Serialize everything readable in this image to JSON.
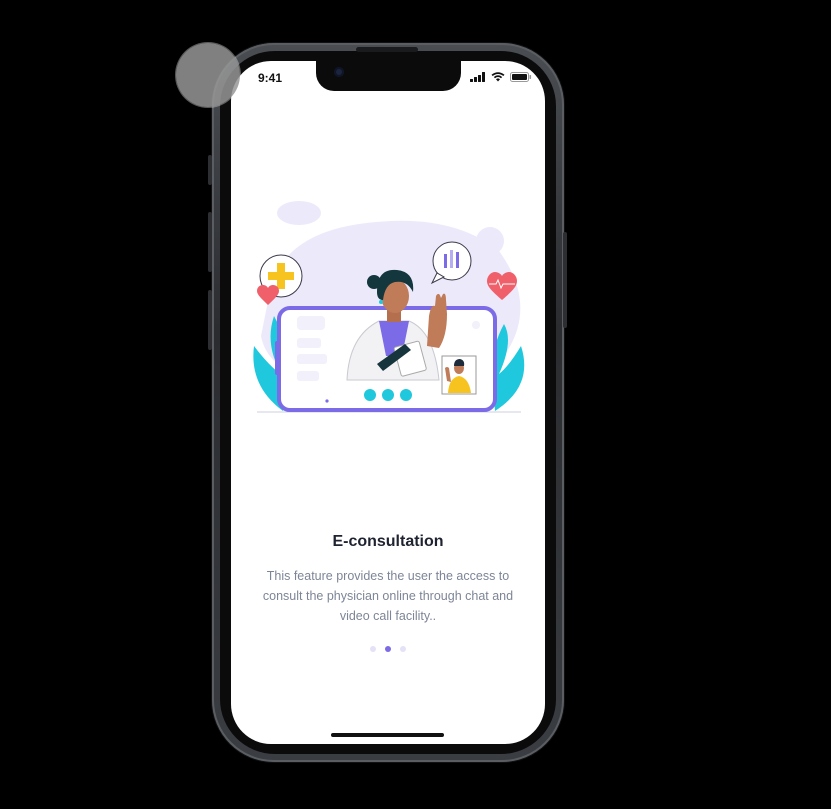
{
  "status_bar": {
    "time": "9:41",
    "icons": [
      "signal-icon",
      "wifi-icon",
      "battery-icon"
    ]
  },
  "onboarding": {
    "title": "E-consultation",
    "description": "This feature provides the user the access to consult the physician online through chat and video call facility..",
    "page_indicator": {
      "total": 3,
      "active_index": 1
    }
  },
  "colors": {
    "accent": "#7b6be6",
    "title_text": "#1f2330",
    "body_text": "#7d8597",
    "teal": "#1fc8dd",
    "heart": "#f0606a",
    "plus": "#f7c31e"
  }
}
